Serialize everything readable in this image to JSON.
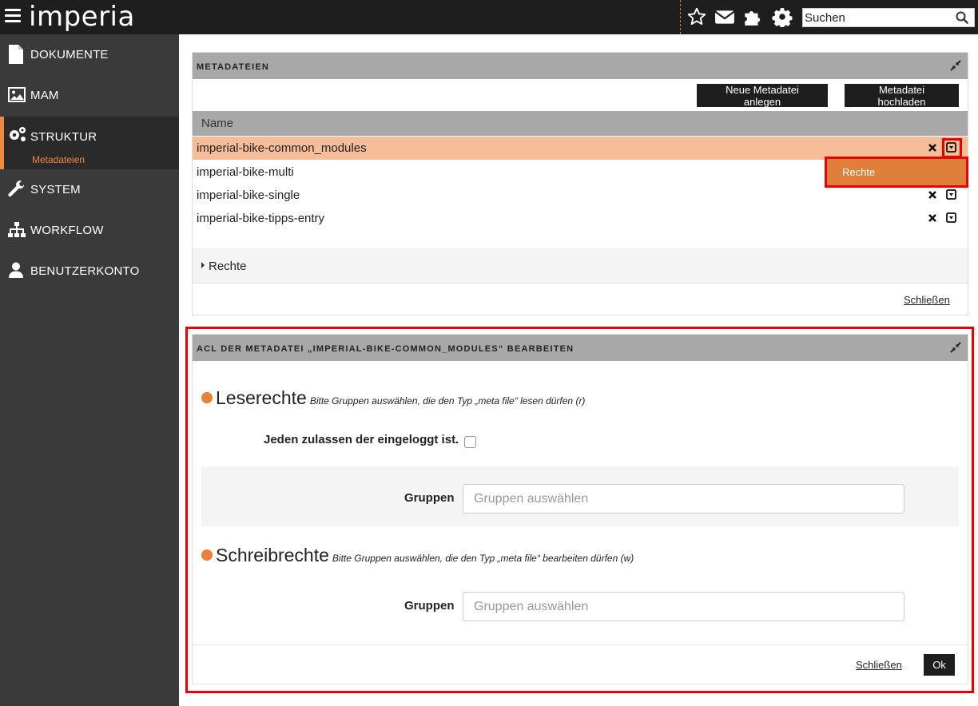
{
  "header": {
    "logo_text": "imperia",
    "search_placeholder": "Suchen",
    "icons": [
      "menu-icon",
      "star-icon",
      "mail-icon",
      "puzzle-icon",
      "gear-icon",
      "search-icon"
    ]
  },
  "sidebar": {
    "items": [
      {
        "label": "DOKUMENTE",
        "icon": "document-icon"
      },
      {
        "label": "MAM",
        "icon": "image-icon"
      },
      {
        "label": "STRUKTUR",
        "icon": "gears-icon",
        "active": true,
        "sub": "Metadateien"
      },
      {
        "label": "SYSTEM",
        "icon": "wrench-icon"
      },
      {
        "label": "WORKFLOW",
        "icon": "sitemap-icon"
      },
      {
        "label": "BENUTZERKONTO",
        "icon": "user-icon"
      }
    ]
  },
  "metadateien": {
    "title": "METADATEIEN",
    "new_button": "Neue Metadatei anlegen",
    "upload_button": "Metadatei hochladen",
    "column_name": "Name",
    "rows": [
      "imperial-bike-common_modules",
      "imperial-bike-multi",
      "imperial-bike-single",
      "imperial-bike-tipps-entry"
    ],
    "dropdown_item": "Rechte",
    "rechte_label": "Rechte",
    "close_link": "Schließen"
  },
  "acl": {
    "title": "ACL DER METADATEI „IMPERIAL-BIKE-COMMON_MODULES“ BEARBEITEN",
    "read": {
      "heading": "Leserechte",
      "hint": "Bitte Gruppen auswählen, die den Typ „meta file“ lesen dürfen (r)",
      "allow_label": "Jeden zulassen der eingeloggt ist.",
      "groups_label": "Gruppen",
      "groups_placeholder": "Gruppen auswählen"
    },
    "write": {
      "heading": "Schreibrechte",
      "hint": "Bitte Gruppen auswählen, die den Typ „meta file“ bearbeiten dürfen (w)",
      "groups_label": "Gruppen",
      "groups_placeholder": "Gruppen auswählen"
    },
    "close_link": "Schließen",
    "ok_button": "Ok"
  },
  "colors": {
    "accent": "#f08a3c",
    "selected_row": "#f5bd98",
    "highlight_border": "#ee0000"
  }
}
